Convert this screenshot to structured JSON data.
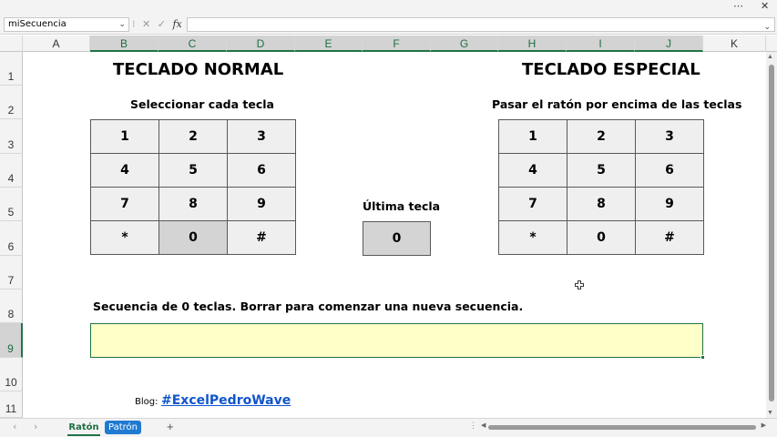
{
  "window": {
    "restore_label": "⋯",
    "close_label": "✕"
  },
  "formula_bar": {
    "name_box": "miSecuencia",
    "name_box_arrow": "⌄",
    "sep": "⁝",
    "cancel": "✕",
    "enter": "✓",
    "fx": "fx",
    "formula": "",
    "expand": "⌄"
  },
  "columns": [
    "A",
    "B",
    "C",
    "D",
    "E",
    "F",
    "G",
    "H",
    "I",
    "J",
    "K"
  ],
  "rows": [
    "1",
    "2",
    "3",
    "4",
    "5",
    "6",
    "7",
    "8",
    "9",
    "10",
    "11"
  ],
  "sheet": {
    "normal": {
      "title": "TECLADO NORMAL",
      "subtitle": "Seleccionar cada tecla",
      "keys": [
        [
          "1",
          "2",
          "3"
        ],
        [
          "4",
          "5",
          "6"
        ],
        [
          "7",
          "8",
          "9"
        ],
        [
          "*",
          "0",
          "#"
        ]
      ]
    },
    "special": {
      "title": "TECLADO ESPECIAL",
      "subtitle": "Pasar el ratón por encima de las teclas",
      "keys": [
        [
          "1",
          "2",
          "3"
        ],
        [
          "4",
          "5",
          "6"
        ],
        [
          "7",
          "8",
          "9"
        ],
        [
          "*",
          "0",
          "#"
        ]
      ]
    },
    "last_key": {
      "label": "Última tecla",
      "value": "0"
    },
    "sequence": {
      "label": "Secuencia de 0 teclas. Borrar para comenzar una nueva secuencia.",
      "value": ""
    },
    "blog": {
      "label": "Blog:",
      "link": "#ExcelPedroWave"
    }
  },
  "tabs": {
    "prev": "‹",
    "next": "›",
    "items": [
      "Ratón",
      "Patrón"
    ],
    "add": "+",
    "more": "⋮"
  },
  "colors": {
    "accent": "#217346",
    "sequence_bg": "#ffffc8",
    "pressed": "#d4d4d4",
    "link": "#1155cc",
    "tab_active_bg": "#1f7ad1"
  }
}
